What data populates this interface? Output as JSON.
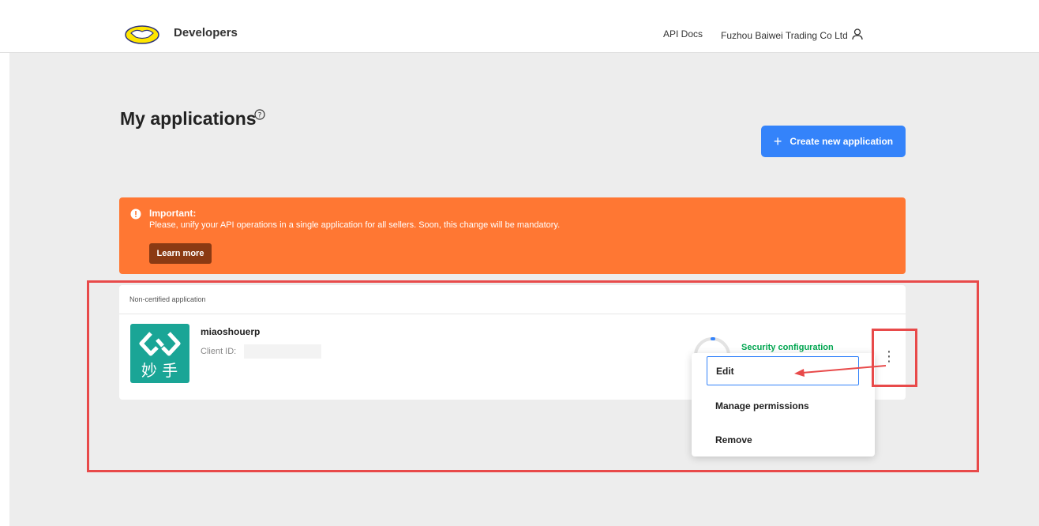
{
  "header": {
    "brand": "Developers",
    "api_docs": "API Docs",
    "account_name": "Fuzhou Baiwei Trading Co Ltd"
  },
  "page": {
    "title": "My applications",
    "create_button": "Create new application"
  },
  "banner": {
    "title": "Important:",
    "text": "Please, unify your API operations in a single application for all sellers. Soon, this change will be mandatory.",
    "learn_more": "Learn more"
  },
  "app_card": {
    "section_label": "Non-certified application",
    "app_name": "miaoshouerp",
    "client_id_label": "Client ID: ",
    "logo_text": "妙 手",
    "security_configuration": "Security configuration",
    "spinner_value": "0"
  },
  "menu": {
    "items": [
      "Edit",
      "Manage permissions",
      "Remove"
    ]
  },
  "colors": {
    "primary": "#3483fa",
    "warning": "#ff7733",
    "success": "#00a650",
    "annotation": "#e84a4a"
  }
}
